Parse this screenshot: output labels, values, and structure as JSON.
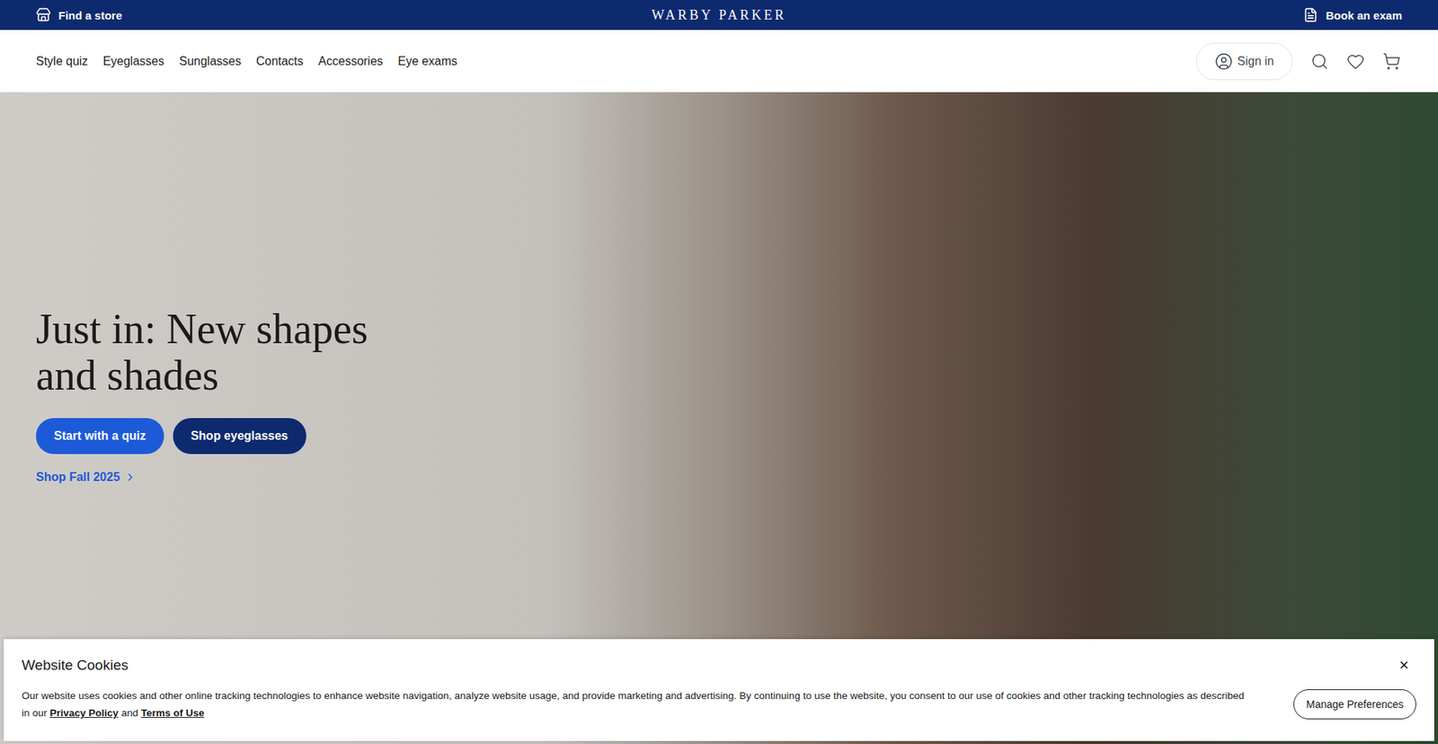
{
  "top_bar": {
    "find_store": "Find a store",
    "logo": "WARBY PARKER",
    "book_exam": "Book an exam"
  },
  "nav": {
    "items": [
      "Style quiz",
      "Eyeglasses",
      "Sunglasses",
      "Contacts",
      "Accessories",
      "Eye exams"
    ],
    "sign_in": "Sign in"
  },
  "hero": {
    "heading_lines": [
      "Just in: New shapes",
      "and shades"
    ],
    "buttons": [
      {
        "label": "Start with a quiz",
        "kind": "primary"
      },
      {
        "label": "Shop eyeglasses",
        "kind": "secondary"
      }
    ],
    "link": "Shop Fall 2025"
  },
  "cookie_banner": {
    "title": "Website Cookies",
    "close": "×",
    "text": "Our website uses cookies and other online tracking technologies to enhance website navigation, analyze website usage, and provide marketing and advertising. By continuing to use the website, you consent to our use of cookies and other tracking technologies as described in our",
    "links": [
      "Privacy Policy",
      "Terms of Use"
    ],
    "joiner": "and",
    "button": "Manage Preferences"
  }
}
